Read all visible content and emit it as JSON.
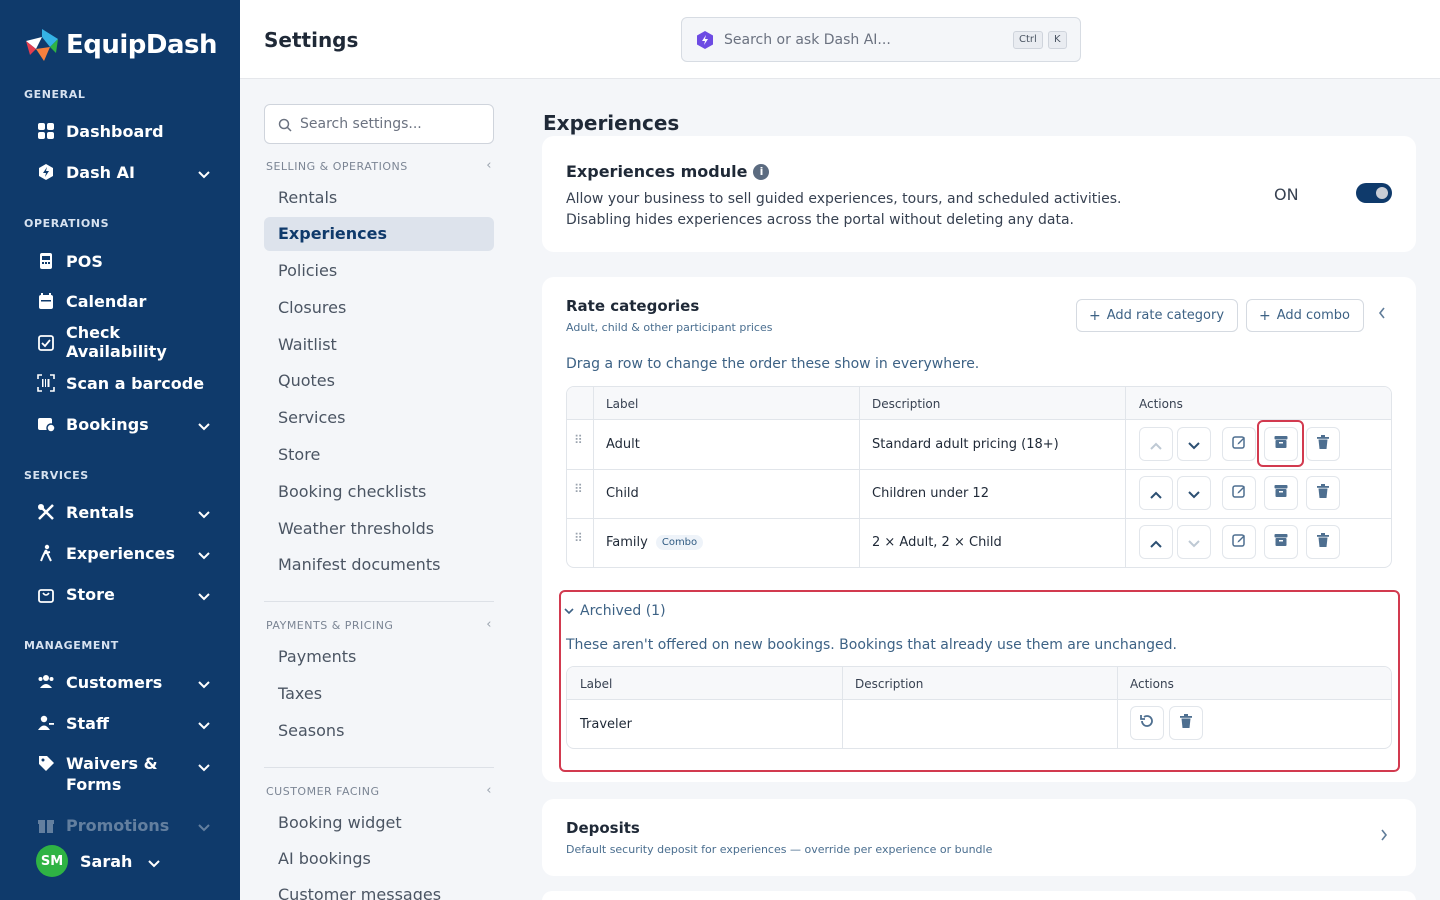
{
  "brand": {
    "name": "EquipDash"
  },
  "sidebar": {
    "sections": [
      "GENERAL",
      "OPERATIONS",
      "SERVICES",
      "MANAGEMENT"
    ],
    "items": [
      {
        "label": "Dashboard",
        "icon": "dashboard-icon"
      },
      {
        "label": "Dash AI",
        "icon": "dash-ai-icon"
      },
      {
        "label": "POS",
        "icon": "pos-icon"
      },
      {
        "label": "Calendar",
        "icon": "calendar-icon"
      },
      {
        "label": "Check Availability",
        "icon": "check-availability-icon"
      },
      {
        "label": "Scan a barcode",
        "icon": "barcode-icon"
      },
      {
        "label": "Bookings",
        "icon": "bookings-icon"
      },
      {
        "label": "Rentals",
        "icon": "rentals-icon"
      },
      {
        "label": "Experiences",
        "icon": "experiences-icon"
      },
      {
        "label": "Store",
        "icon": "store-icon"
      },
      {
        "label": "Customers",
        "icon": "customers-icon"
      },
      {
        "label": "Staff",
        "icon": "staff-icon"
      },
      {
        "label": "Waivers & Forms",
        "icon": "waivers-icon"
      },
      {
        "label": "Promotions",
        "icon": "promotions-icon"
      }
    ],
    "user": {
      "initials": "SM",
      "name": "Sarah"
    }
  },
  "header": {
    "title": "Settings",
    "search_placeholder": "Search or ask Dash AI...",
    "kbd1": "Ctrl",
    "kbd2": "K"
  },
  "settings_nav": {
    "search_placeholder": "Search settings...",
    "groups": [
      {
        "title": "SELLING & OPERATIONS",
        "items": [
          "Rentals",
          "Experiences",
          "Policies",
          "Closures",
          "Waitlist",
          "Quotes",
          "Services",
          "Store",
          "Booking checklists",
          "Weather thresholds",
          "Manifest documents"
        ]
      },
      {
        "title": "PAYMENTS & PRICING",
        "items": [
          "Payments",
          "Taxes",
          "Seasons"
        ]
      },
      {
        "title": "CUSTOMER FACING",
        "items": [
          "Booking widget",
          "AI bookings",
          "Customer messages"
        ]
      }
    ],
    "active": "Experiences"
  },
  "main": {
    "heading": "Experiences",
    "module": {
      "title": "Experiences module",
      "desc1": "Allow your business to sell guided experiences, tours, and scheduled activities.",
      "desc2": "Disabling hides experiences across the portal without deleting any data.",
      "state": "ON"
    },
    "rates": {
      "title": "Rate categories",
      "subtitle": "Adult, child & other participant prices",
      "add_rate": "Add rate category",
      "add_combo": "Add combo",
      "hint": "Drag a row to change the order these show in everywhere.",
      "columns": [
        "Label",
        "Description",
        "Actions"
      ],
      "rows": [
        {
          "label": "Adult",
          "badge": "",
          "description": "Standard adult pricing (18+)"
        },
        {
          "label": "Child",
          "badge": "",
          "description": "Children under 12"
        },
        {
          "label": "Family",
          "badge": "Combo",
          "description": "2 × Adult, 2 × Child"
        }
      ],
      "archived_toggle": "Archived (1)",
      "archived_note": "These aren't offered on new bookings. Bookings that already use them are unchanged.",
      "archived_rows": [
        {
          "label": "Traveler",
          "description": ""
        }
      ]
    },
    "deposits": {
      "title": "Deposits",
      "subtitle": "Default security deposit for experiences — override per experience or bundle"
    }
  },
  "colors": {
    "sidebar": "#0f3a6b",
    "accent_text": "#3d6285",
    "highlight": "#d23a4f",
    "avatar": "#2fb344"
  }
}
